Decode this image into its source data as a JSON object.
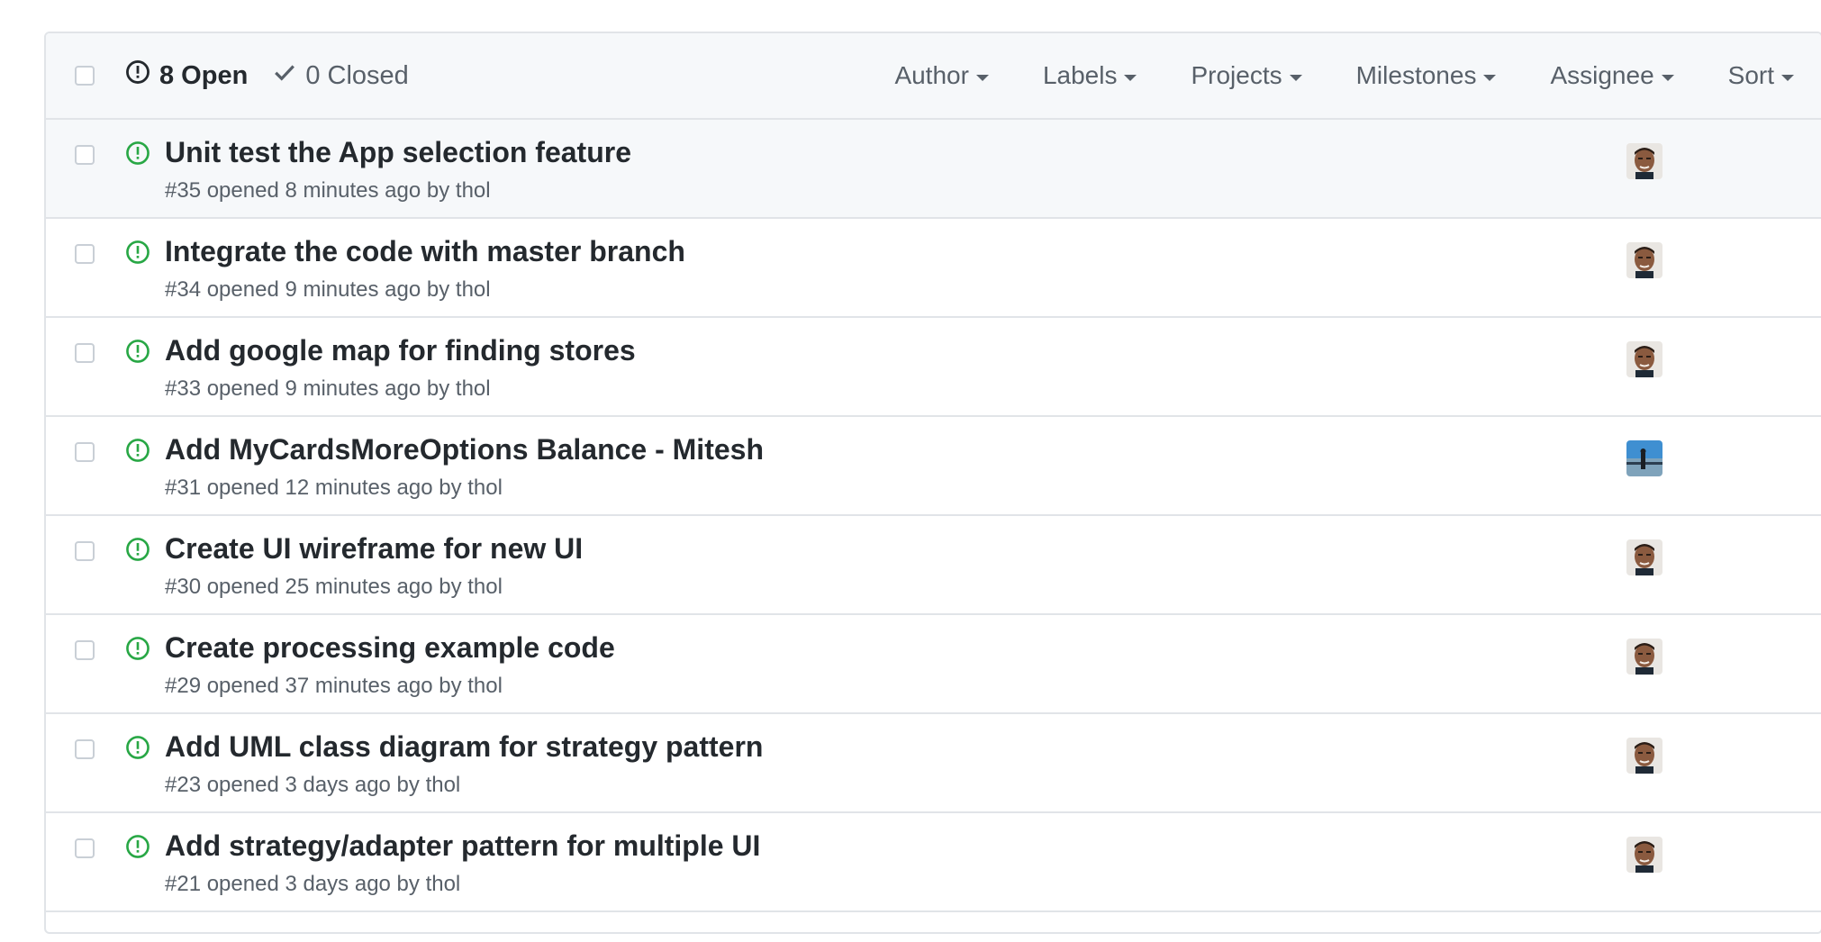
{
  "header": {
    "open_label": "8 Open",
    "closed_label": "0 Closed",
    "filters": [
      "Author",
      "Labels",
      "Projects",
      "Milestones",
      "Assignee",
      "Sort"
    ]
  },
  "issues": [
    {
      "title": "Unit test the App selection feature",
      "meta": "#35 opened 8 minutes ago by thol",
      "avatar": "face"
    },
    {
      "title": "Integrate the code with master branch",
      "meta": "#34 opened 9 minutes ago by thol",
      "avatar": "face"
    },
    {
      "title": "Add google map for finding stores",
      "meta": "#33 opened 9 minutes ago by thol",
      "avatar": "face"
    },
    {
      "title": "Add MyCardsMoreOptions Balance - Mitesh",
      "meta": "#31 opened 12 minutes ago by thol",
      "avatar": "landscape"
    },
    {
      "title": "Create UI wireframe for new UI",
      "meta": "#30 opened 25 minutes ago by thol",
      "avatar": "face"
    },
    {
      "title": "Create processing example code",
      "meta": "#29 opened 37 minutes ago by thol",
      "avatar": "face"
    },
    {
      "title": "Add UML class diagram for strategy pattern",
      "meta": "#23 opened 3 days ago by thol",
      "avatar": "face"
    },
    {
      "title": "Add strategy/adapter pattern for multiple UI",
      "meta": "#21 opened 3 days ago by thol",
      "avatar": "face"
    }
  ],
  "colors": {
    "open_icon": "#28a745",
    "text": "#24292e",
    "muted": "#586069",
    "border": "#e1e4e8",
    "header_bg": "#f6f8fa"
  }
}
